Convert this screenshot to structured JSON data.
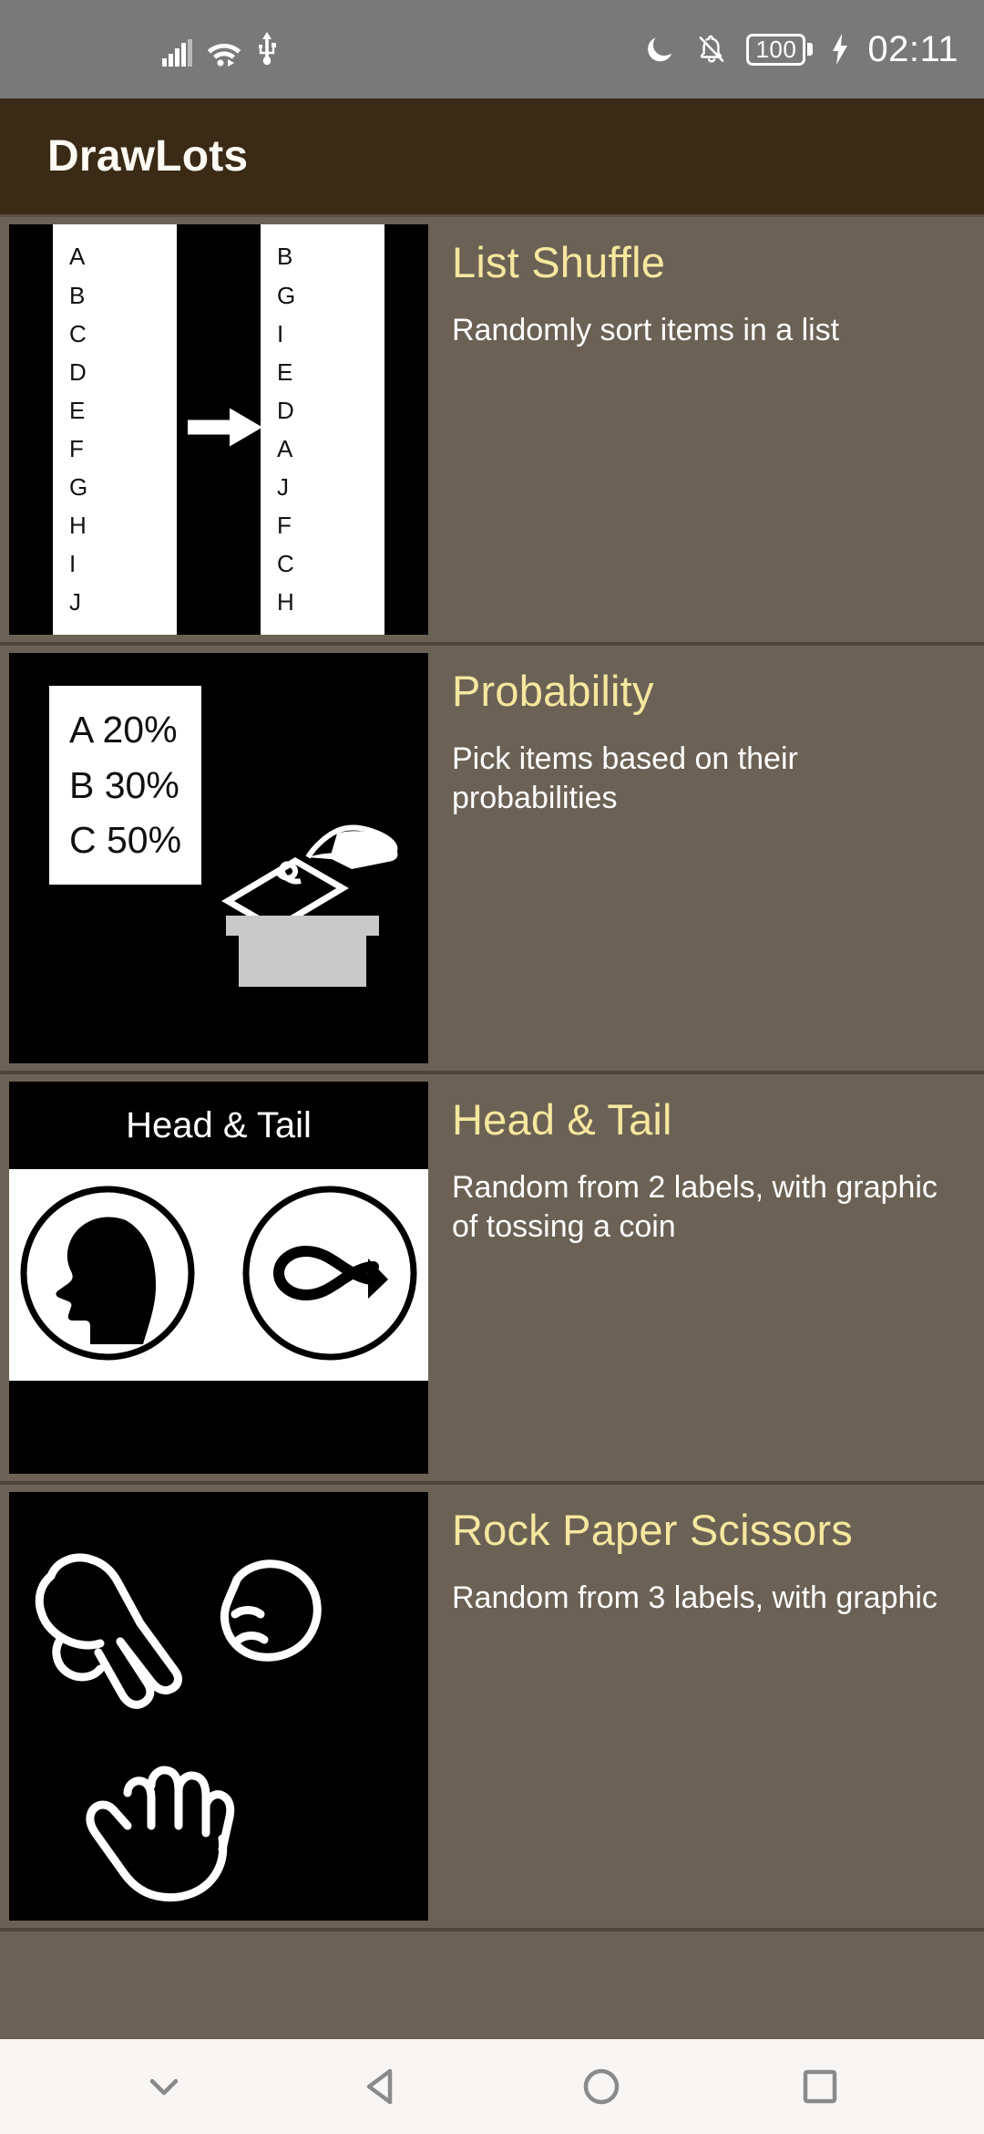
{
  "status_bar": {
    "icons_left": [
      "signal-icon",
      "wifi-icon",
      "usb-icon"
    ],
    "icons_right": [
      "moon-icon",
      "bell-off-icon",
      "battery-icon",
      "charging-bolt-icon"
    ],
    "battery_level": "100",
    "time": "02:11"
  },
  "app_bar": {
    "title": "DrawLots"
  },
  "items": [
    {
      "title": "List Shuffle",
      "description": "Randomly sort items in a list",
      "thumbnail": {
        "kind": "list-shuffle-thumbnail",
        "source_list": [
          "A",
          "B",
          "C",
          "D",
          "E",
          "F",
          "G",
          "H",
          "I",
          "J"
        ],
        "shuffled_list": [
          "B",
          "G",
          "I",
          "E",
          "D",
          "A",
          "J",
          "F",
          "C",
          "H"
        ],
        "arrow": "arrow-right-icon"
      }
    },
    {
      "title": "Probability",
      "description": "Pick items based on their probabilities",
      "thumbnail": {
        "kind": "probability-thumbnail",
        "entries": [
          "A 20%",
          "B 30%",
          "C 50%"
        ],
        "graphic": "ballot-box-icon"
      }
    },
    {
      "title": "Head & Tail",
      "description": "Random from 2 labels, with graphic of tossing a coin",
      "thumbnail": {
        "kind": "head-tail-thumbnail",
        "caption": "Head & Tail",
        "coins": [
          "head-coin-icon",
          "tail-coin-icon"
        ]
      }
    },
    {
      "title": "Rock Paper Scissors",
      "description": "Random from 3 labels, with graphic",
      "thumbnail": {
        "kind": "rock-paper-scissors-thumbnail",
        "hands": [
          "scissors-hand-icon",
          "rock-hand-icon",
          "paper-hand-icon"
        ]
      }
    }
  ],
  "nav_bar": {
    "buttons": [
      "hide-keyboard-icon",
      "back-icon",
      "home-icon",
      "recents-icon"
    ]
  },
  "colors": {
    "app_bar_bg": "#3a2a16",
    "list_bg": "#6b6154",
    "title_accent": "#f5e79e",
    "status_bar_bg": "#797979",
    "nav_bar_bg": "#f7f6f4",
    "thumb_bg": "#000000"
  }
}
